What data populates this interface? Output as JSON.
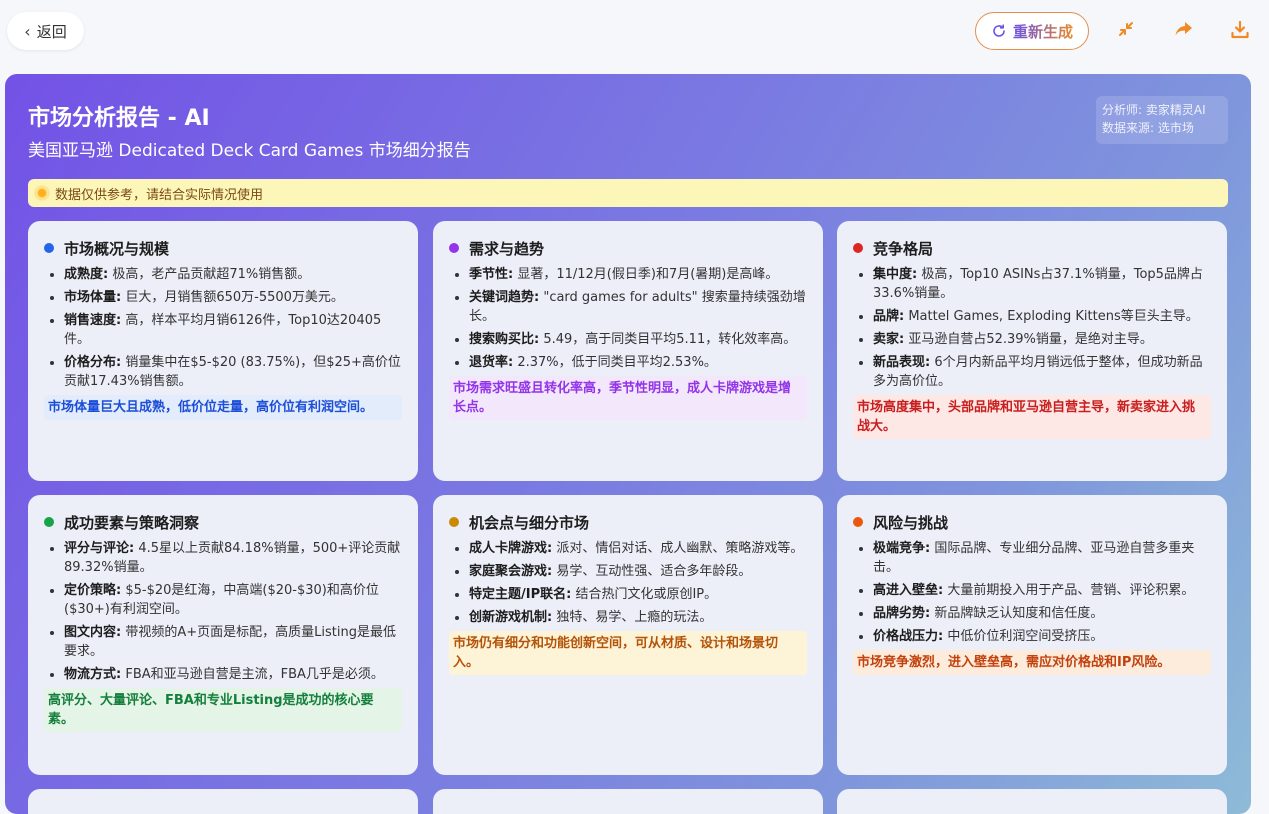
{
  "topbar": {
    "back_label": "返回",
    "regen_label": "重新生成",
    "icons": [
      "chevron-left-icon",
      "refresh-icon",
      "collapse-icon",
      "share-icon",
      "download-icon"
    ],
    "accent_color": "#f08a24"
  },
  "report": {
    "title": "市场分析报告 - AI",
    "subtitle": "美国亚马逊 Dedicated Deck Card Games 市场细分报告",
    "analyst": "分析师: 卖家精灵AI",
    "source": "数据来源: 选市场",
    "notice": "数据仅供参考，请结合实际情况使用"
  },
  "cards": [
    {
      "title": "市场概况与规模",
      "dot_color": "#2563eb",
      "items": [
        {
          "label": "成熟度:",
          "text": " 极高，老产品贡献超71%销售额。"
        },
        {
          "label": "市场体量:",
          "text": " 巨大，月销售额650万-5500万美元。"
        },
        {
          "label": "销售速度:",
          "text": " 高，样本平均月销6126件，Top10达20405件。"
        },
        {
          "label": "价格分布:",
          "text": " 销量集中在$5-$20 (83.75%)，但$25+高价位贡献17.43%销售额。"
        }
      ],
      "summary": "市场体量巨大且成熟，低价位走量，高价位有利润空间。",
      "summary_color": "#1d4ed8",
      "summary_bg": "#e3ecfb"
    },
    {
      "title": "需求与趋势",
      "dot_color": "#9333ea",
      "items": [
        {
          "label": "季节性:",
          "text": " 显著，11/12月(假日季)和7月(暑期)是高峰。"
        },
        {
          "label": "关键词趋势:",
          "text": " \"card games for adults\" 搜索量持续强劲增长。"
        },
        {
          "label": "搜索购买比:",
          "text": " 5.49，高于同类目平均5.11，转化效率高。"
        },
        {
          "label": "退货率:",
          "text": " 2.37%，低于同类目平均2.53%。"
        }
      ],
      "summary": "市场需求旺盛且转化率高，季节性明显，成人卡牌游戏是增长点。",
      "summary_color": "#9333ea",
      "summary_bg": "#f3e8fb"
    },
    {
      "title": "竞争格局",
      "dot_color": "#dc2626",
      "items": [
        {
          "label": "集中度:",
          "text": " 极高，Top10 ASINs占37.1%销量，Top5品牌占33.6%销量。"
        },
        {
          "label": "品牌:",
          "text": " Mattel Games, Exploding Kittens等巨头主导。"
        },
        {
          "label": "卖家:",
          "text": " 亚马逊自营占52.39%销量，是绝对主导。"
        },
        {
          "label": "新品表现:",
          "text": " 6个月内新品平均月销远低于整体，但成功新品多为高价位。"
        }
      ],
      "summary": "市场高度集中，头部品牌和亚马逊自营主导，新卖家进入挑战大。",
      "summary_color": "#c81e1e",
      "summary_bg": "#fde8e6"
    },
    {
      "title": "成功要素与策略洞察",
      "dot_color": "#16a34a",
      "items": [
        {
          "label": "评分与评论:",
          "text": " 4.5星以上贡献84.18%销量，500+评论贡献89.32%销量。"
        },
        {
          "label": "定价策略:",
          "text": " $5-$20是红海，中高端($20-$30)和高价位($30+)有利润空间。"
        },
        {
          "label": "图文内容:",
          "text": " 带视频的A+页面是标配，高质量Listing是最低要求。"
        },
        {
          "label": "物流方式:",
          "text": " FBA和亚马逊自营是主流，FBA几乎是必须。"
        }
      ],
      "summary": "高评分、大量评论、FBA和专业Listing是成功的核心要素。",
      "summary_color": "#15803d",
      "summary_bg": "#e4f4e6"
    },
    {
      "title": "机会点与细分市场",
      "dot_color": "#ca8a04",
      "items": [
        {
          "label": "成人卡牌游戏:",
          "text": " 派对、情侣对话、成人幽默、策略游戏等。"
        },
        {
          "label": "家庭聚会游戏:",
          "text": " 易学、互动性强、适合多年龄段。"
        },
        {
          "label": "特定主题/IP联名:",
          "text": " 结合热门文化或原创IP。"
        },
        {
          "label": "创新游戏机制:",
          "text": " 独特、易学、上瘾的玩法。"
        }
      ],
      "summary": "市场仍有细分和功能创新空间，可从材质、设计和场景切入。",
      "summary_color": "#b45309",
      "summary_bg": "#fdf3d6"
    },
    {
      "title": "风险与挑战",
      "dot_color": "#ea580c",
      "items": [
        {
          "label": "极端竞争:",
          "text": " 国际品牌、专业细分品牌、亚马逊自营多重夹击。"
        },
        {
          "label": "高进入壁垒:",
          "text": " 大量前期投入用于产品、营销、评论积累。"
        },
        {
          "label": "品牌劣势:",
          "text": " 新品牌缺乏认知度和信任度。"
        },
        {
          "label": "价格战压力:",
          "text": " 中低价位利润空间受挤压。"
        }
      ],
      "summary": "市场竞争激烈，进入壁垒高，需应对价格战和IP风险。",
      "summary_color": "#c2410c",
      "summary_bg": "#fdebdc"
    }
  ]
}
